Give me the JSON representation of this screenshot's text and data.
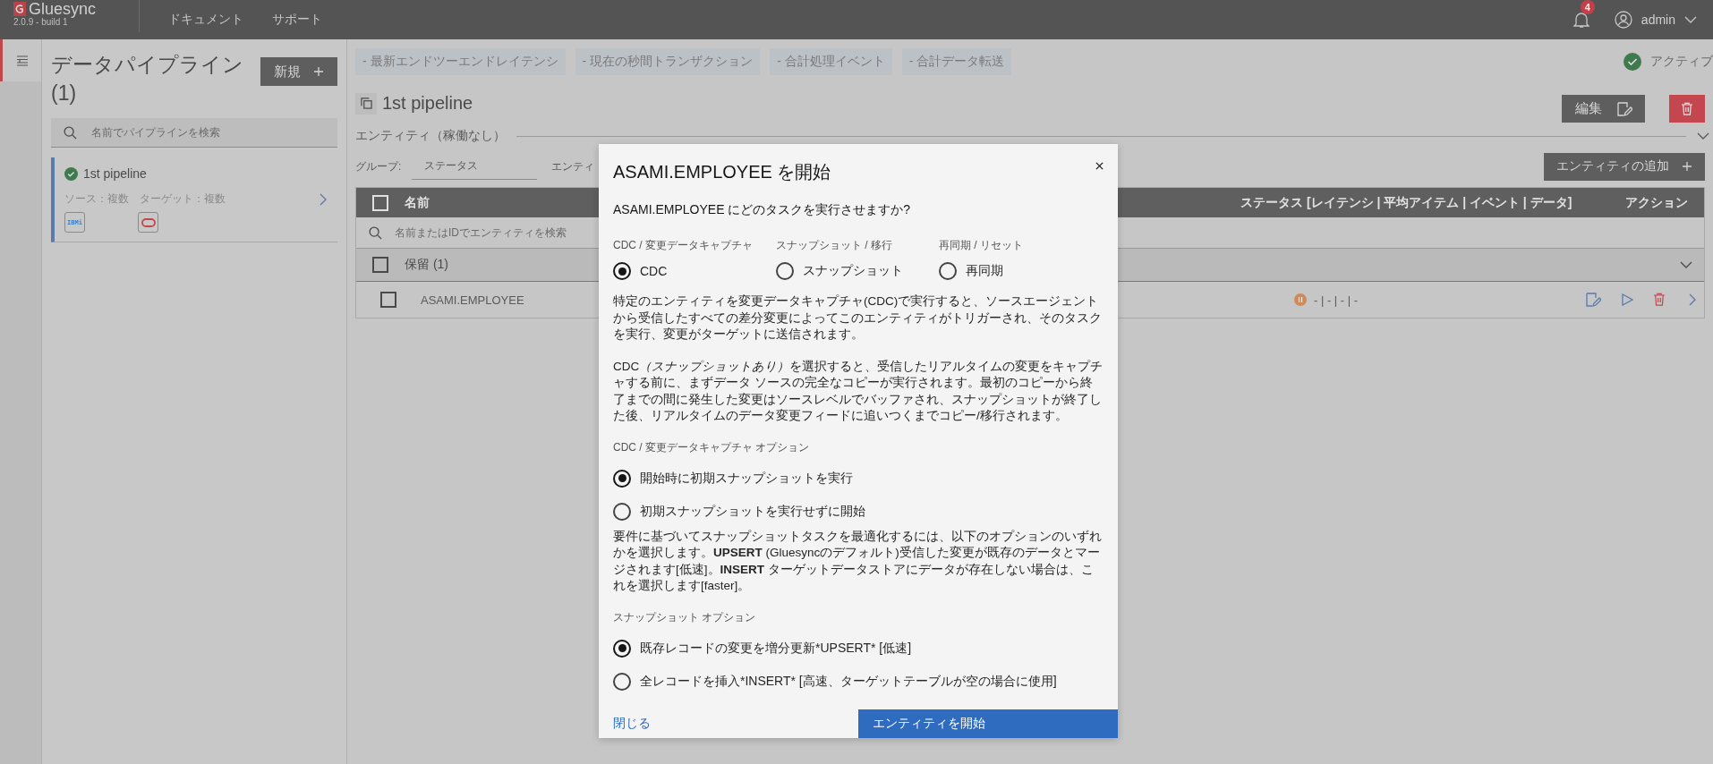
{
  "header": {
    "logo": "Gluesync",
    "version": "2.0.9 - build 1",
    "nav": [
      "ドキュメント",
      "サポート"
    ],
    "notifications": "4",
    "user": "admin"
  },
  "sidebar": {
    "title": "データパイプライン (1)",
    "new_button": "新規",
    "search_placeholder": "名前でパイプラインを検索",
    "pipelines": [
      {
        "name": "1st pipeline",
        "selected": true,
        "source": "ソース：複数",
        "target": "ターゲット：複数",
        "source_logo": "IBMi"
      }
    ]
  },
  "main": {
    "metrics": [
      "- 最新エンドツーエンドレイテンシ",
      "- 現在の秒間トランザクション",
      "- 合計処理イベント",
      "- 合計データ転送"
    ],
    "status": "アクティブ",
    "pipeline_title": "1st pipeline",
    "edit_button": "編集",
    "entities_heading": "エンティティ（稼働なし）",
    "group_label": "グループ:",
    "group_value": "ステータス",
    "filter_label": "エンティ",
    "add_entity_button": "エンティティの追加",
    "table": {
      "columns": [
        "名前",
        "ステータス [レイテンシ | 平均アイテム | イベント | データ]",
        "アクション"
      ],
      "all_checked": false,
      "search_placeholder": "名前またはIDでエンティティを検索",
      "groups": [
        {
          "label": "保留 (1)",
          "checked": false,
          "expanded": true,
          "rows": [
            {
              "name": "ASAMI.EMPLOYEE",
              "checked": false,
              "status": "- | - | - | -"
            }
          ]
        }
      ]
    }
  },
  "dialog": {
    "title": "ASAMI.EMPLOYEE を開始",
    "question": "ASAMI.EMPLOYEE にどのタスクを実行させますか?",
    "task_types": [
      {
        "caption": "CDC / 変更データキャプチャ",
        "label": "CDC",
        "selected": true
      },
      {
        "caption": "スナップショット / 移行",
        "label": "スナップショット",
        "selected": false
      },
      {
        "caption": "再同期 / リセット",
        "label": "再同期",
        "selected": false
      }
    ],
    "descriptions": [
      "特定のエンティティを変更データキャプチャ(CDC)で実行すると、ソースエージェントから受信したすべての差分変更によってこのエンティティがトリガーされ、そのタスクを実行、変更がターゲットに送信されます。",
      {
        "lead": "CDC",
        "emphasis": "（スナップショットあり）",
        "rest": "を選択すると、受信したリアルタイムの変更をキャプチャする前に、まずデータ ソースの完全なコピーが実行されます。最初のコピーから終了までの間に発生した変更はソースレベルでバッファされ、スナップショットが終了した後、リアルタイムのデータ変更フィードに追いつくまでコピー/移行されます。"
      }
    ],
    "cdc_options_label": "CDC / 変更データキャプチャ オプション",
    "cdc_options": [
      {
        "label": "開始時に初期スナップショットを実行",
        "selected": true
      },
      {
        "label": "初期スナップショットを実行せずに開始",
        "selected": false
      }
    ],
    "snapshot_note": "要件に基づいてスナップショットタスクを最適化するには、以下のオプションのいずれかを選択します。**UPSERT** (Gluesyncのデフォルト)受信した変更が既存のデータとマージされます[低速]。**INSERT** ターゲットデータストアにデータが存在しない場合は、これを選択します[faster]。",
    "snapshot_options_label": "スナップショット オプション",
    "snapshot_options": [
      {
        "label": "既存レコードの変更を増分更新*UPSERT* [低速]",
        "selected": true
      },
      {
        "label": "全レコードを挿入*INSERT* [高速、ターゲットテーブルが空の場合に使用]",
        "selected": false
      }
    ],
    "close_link": "閉じる",
    "start_button": "エンティティを開始"
  }
}
